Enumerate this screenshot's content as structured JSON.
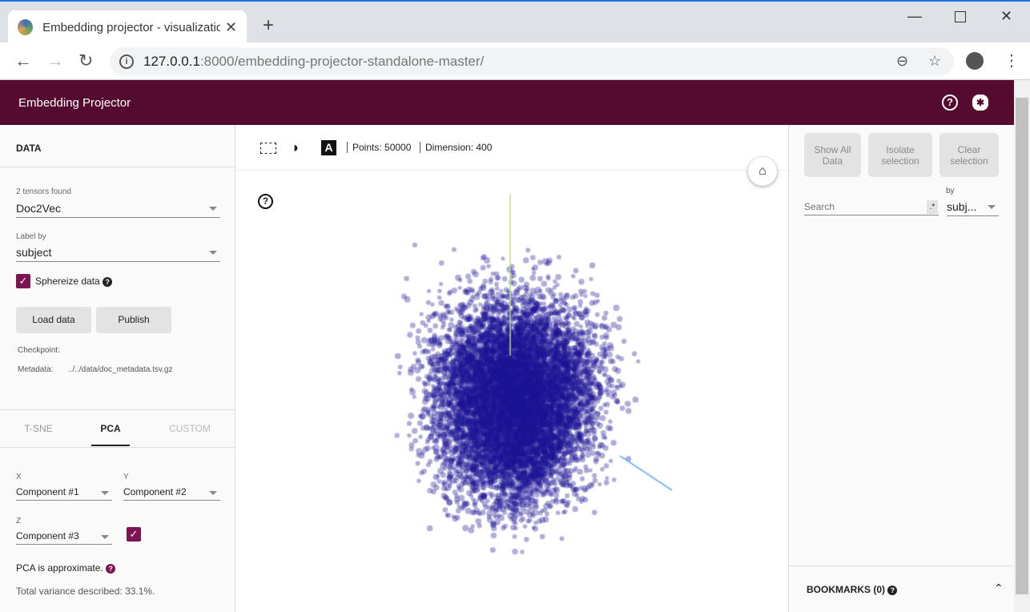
{
  "browser": {
    "tab_title": "Embedding projector - visualization",
    "url_host": "127.0.0.1",
    "url_path": ":8000/embedding-projector-standalone-master/"
  },
  "header": {
    "title": "Embedding Projector",
    "help_icon": "help-circle-icon",
    "bug_icon": "bug-icon"
  },
  "data_panel": {
    "title": "DATA",
    "tensors_label": "2 tensors found",
    "tensor_value": "Doc2Vec",
    "label_by_label": "Label by",
    "label_by_value": "subject",
    "sphereize_label": "Sphereize data",
    "sphereize_checked": true,
    "load_button": "Load data",
    "publish_button": "Publish",
    "checkpoint_label": "Checkpoint:",
    "metadata_label": "Metadata:",
    "metadata_value": "../../data/doc_metadata.tsv.gz"
  },
  "projection": {
    "tabs": [
      "T-SNE",
      "PCA",
      "CUSTOM"
    ],
    "active_tab": "PCA",
    "x_label": "X",
    "x_value": "Component #1",
    "y_label": "Y",
    "y_value": "Component #2",
    "z_label": "Z",
    "z_value": "Component #3",
    "z_enabled": true,
    "approx_text": "PCA is approximate.",
    "variance_text": "Total variance described: 33.1%."
  },
  "viewer": {
    "points_text": "Points: 50000",
    "dimension_text": "Dimension: 400",
    "point_color": "#1a1a8c"
  },
  "inspector": {
    "show_all": "Show All Data",
    "isolate": "Isolate selection",
    "clear": "Clear selection",
    "search_placeholder": "Search",
    "regex_label": ".*",
    "by_label": "by",
    "by_value": "subj...",
    "bookmarks": "BOOKMARKS (0)"
  },
  "colors": {
    "accent": "#550a2f",
    "checkbox": "#7b1450"
  }
}
